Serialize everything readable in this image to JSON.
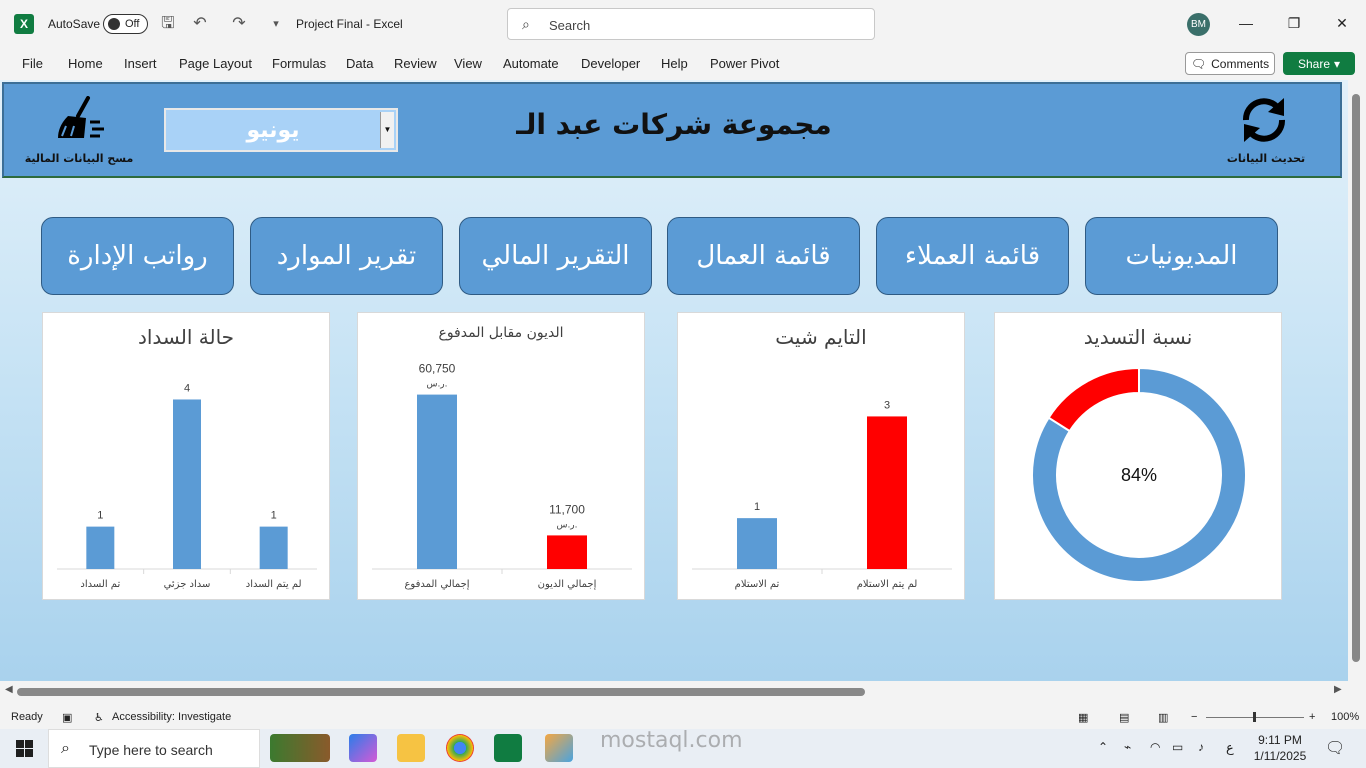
{
  "titlebar": {
    "autosave_label": "AutoSave",
    "autosave_state": "Off",
    "doc_title": "Project Final  -  Excel",
    "search_placeholder": "Search",
    "user_initials": "BM"
  },
  "ribbon": {
    "tabs": [
      "File",
      "Home",
      "Insert",
      "Page Layout",
      "Formulas",
      "Data",
      "Review",
      "View",
      "Automate",
      "Developer",
      "Help",
      "Power Pivot"
    ],
    "comments_label": "Comments",
    "share_label": "Share"
  },
  "dashboard": {
    "title": "مجموعة شركات عبد الـ",
    "month": "يونيو",
    "clear_label": "مسح البيانات المالية",
    "refresh_label": "تحديث البيانات",
    "nav_buttons": [
      "رواتب الإدارة",
      "تقرير الموارد",
      "التقرير المالي",
      "قائمة العمال",
      "قائمة العملاء",
      "المديونيات"
    ]
  },
  "chart_data": [
    {
      "type": "bar",
      "title": "حالة السداد",
      "categories": [
        "تم السداد",
        "سداد جزئي",
        "لم يتم السداد"
      ],
      "values": [
        1,
        4,
        1
      ],
      "colors": [
        "#5b9bd5",
        "#5b9bd5",
        "#5b9bd5"
      ],
      "ylim": [
        0,
        4.2
      ]
    },
    {
      "type": "bar",
      "title": "الديون مقابل المدفوع",
      "categories": [
        "إجمالي المدفوع",
        "إجمالي الديون"
      ],
      "values": [
        60750,
        11700
      ],
      "value_labels": [
        "60,750",
        "11,700"
      ],
      "unit": "ر.س.",
      "colors": [
        "#5b9bd5",
        "#ff0000"
      ],
      "ylim": [
        0,
        62000
      ]
    },
    {
      "type": "bar",
      "title": "التايم شيت",
      "categories": [
        "تم الاستلام",
        "لم يتم الاستلام"
      ],
      "values": [
        1,
        3
      ],
      "colors": [
        "#5b9bd5",
        "#ff0000"
      ],
      "ylim": [
        0,
        3.5
      ]
    },
    {
      "type": "pie",
      "title": "نسبة التسديد",
      "center_label": "84%",
      "values": [
        84,
        16
      ],
      "colors": [
        "#5b9bd5",
        "#ff0000"
      ]
    }
  ],
  "status": {
    "ready": "Ready",
    "accessibility": "Accessibility: Investigate",
    "zoom": "100%"
  },
  "taskbar": {
    "search_placeholder": "Type here to search",
    "time": "9:11 PM",
    "date": "1/11/2025",
    "lang": "ع"
  },
  "watermark": "mostaql.com"
}
